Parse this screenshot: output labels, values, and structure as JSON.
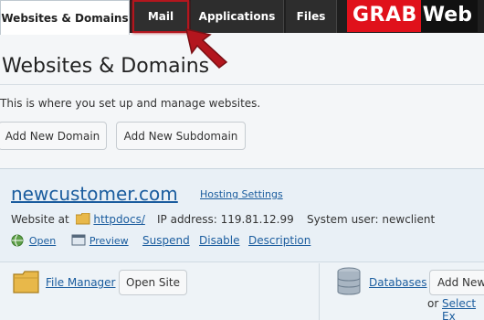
{
  "tabs": [
    {
      "label": "Websites & Domains"
    },
    {
      "label": "Mail"
    },
    {
      "label": "Applications"
    },
    {
      "label": "Files"
    }
  ],
  "logo": {
    "part1": "GRAB",
    "part2": "Web"
  },
  "page": {
    "title": "Websites & Domains",
    "description": "This is where you set up and manage websites.",
    "add_domain": "Add New Domain",
    "add_subdomain": "Add New Subdomain"
  },
  "domain": {
    "name": "newcustomer.com",
    "hosting_settings": "Hosting Settings",
    "website_at_label": "Website at",
    "docroot": "httpdocs/",
    "ip_label": "IP address:",
    "ip": "119.81.12.99",
    "user_label": "System user:",
    "user": "newclient",
    "actions": {
      "open": "Open",
      "preview": "Preview",
      "suspend": "Suspend",
      "disable": "Disable",
      "description": "Description"
    }
  },
  "tools": {
    "file_manager": "File Manager",
    "open_site": "Open Site",
    "databases": "Databases",
    "add_new": "Add New",
    "or_label": "or",
    "select_existing": "Select Ex"
  },
  "colors": {
    "accent": "#b3161e",
    "link": "#1a5c9e",
    "brand_red": "#e0111b"
  }
}
